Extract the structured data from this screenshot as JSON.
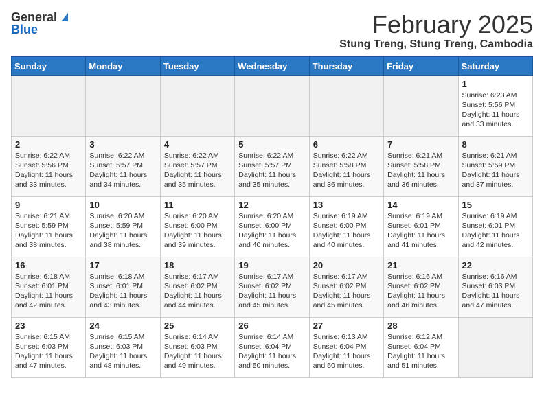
{
  "logo": {
    "general": "General",
    "blue": "Blue"
  },
  "title": "February 2025",
  "location": "Stung Treng, Stung Treng, Cambodia",
  "days_of_week": [
    "Sunday",
    "Monday",
    "Tuesday",
    "Wednesday",
    "Thursday",
    "Friday",
    "Saturday"
  ],
  "weeks": [
    [
      {
        "day": "",
        "info": ""
      },
      {
        "day": "",
        "info": ""
      },
      {
        "day": "",
        "info": ""
      },
      {
        "day": "",
        "info": ""
      },
      {
        "day": "",
        "info": ""
      },
      {
        "day": "",
        "info": ""
      },
      {
        "day": "1",
        "info": "Sunrise: 6:23 AM\nSunset: 5:56 PM\nDaylight: 11 hours\nand 33 minutes."
      }
    ],
    [
      {
        "day": "2",
        "info": "Sunrise: 6:22 AM\nSunset: 5:56 PM\nDaylight: 11 hours\nand 33 minutes."
      },
      {
        "day": "3",
        "info": "Sunrise: 6:22 AM\nSunset: 5:57 PM\nDaylight: 11 hours\nand 34 minutes."
      },
      {
        "day": "4",
        "info": "Sunrise: 6:22 AM\nSunset: 5:57 PM\nDaylight: 11 hours\nand 35 minutes."
      },
      {
        "day": "5",
        "info": "Sunrise: 6:22 AM\nSunset: 5:57 PM\nDaylight: 11 hours\nand 35 minutes."
      },
      {
        "day": "6",
        "info": "Sunrise: 6:22 AM\nSunset: 5:58 PM\nDaylight: 11 hours\nand 36 minutes."
      },
      {
        "day": "7",
        "info": "Sunrise: 6:21 AM\nSunset: 5:58 PM\nDaylight: 11 hours\nand 36 minutes."
      },
      {
        "day": "8",
        "info": "Sunrise: 6:21 AM\nSunset: 5:59 PM\nDaylight: 11 hours\nand 37 minutes."
      }
    ],
    [
      {
        "day": "9",
        "info": "Sunrise: 6:21 AM\nSunset: 5:59 PM\nDaylight: 11 hours\nand 38 minutes."
      },
      {
        "day": "10",
        "info": "Sunrise: 6:20 AM\nSunset: 5:59 PM\nDaylight: 11 hours\nand 38 minutes."
      },
      {
        "day": "11",
        "info": "Sunrise: 6:20 AM\nSunset: 6:00 PM\nDaylight: 11 hours\nand 39 minutes."
      },
      {
        "day": "12",
        "info": "Sunrise: 6:20 AM\nSunset: 6:00 PM\nDaylight: 11 hours\nand 40 minutes."
      },
      {
        "day": "13",
        "info": "Sunrise: 6:19 AM\nSunset: 6:00 PM\nDaylight: 11 hours\nand 40 minutes."
      },
      {
        "day": "14",
        "info": "Sunrise: 6:19 AM\nSunset: 6:01 PM\nDaylight: 11 hours\nand 41 minutes."
      },
      {
        "day": "15",
        "info": "Sunrise: 6:19 AM\nSunset: 6:01 PM\nDaylight: 11 hours\nand 42 minutes."
      }
    ],
    [
      {
        "day": "16",
        "info": "Sunrise: 6:18 AM\nSunset: 6:01 PM\nDaylight: 11 hours\nand 42 minutes."
      },
      {
        "day": "17",
        "info": "Sunrise: 6:18 AM\nSunset: 6:01 PM\nDaylight: 11 hours\nand 43 minutes."
      },
      {
        "day": "18",
        "info": "Sunrise: 6:17 AM\nSunset: 6:02 PM\nDaylight: 11 hours\nand 44 minutes."
      },
      {
        "day": "19",
        "info": "Sunrise: 6:17 AM\nSunset: 6:02 PM\nDaylight: 11 hours\nand 45 minutes."
      },
      {
        "day": "20",
        "info": "Sunrise: 6:17 AM\nSunset: 6:02 PM\nDaylight: 11 hours\nand 45 minutes."
      },
      {
        "day": "21",
        "info": "Sunrise: 6:16 AM\nSunset: 6:02 PM\nDaylight: 11 hours\nand 46 minutes."
      },
      {
        "day": "22",
        "info": "Sunrise: 6:16 AM\nSunset: 6:03 PM\nDaylight: 11 hours\nand 47 minutes."
      }
    ],
    [
      {
        "day": "23",
        "info": "Sunrise: 6:15 AM\nSunset: 6:03 PM\nDaylight: 11 hours\nand 47 minutes."
      },
      {
        "day": "24",
        "info": "Sunrise: 6:15 AM\nSunset: 6:03 PM\nDaylight: 11 hours\nand 48 minutes."
      },
      {
        "day": "25",
        "info": "Sunrise: 6:14 AM\nSunset: 6:03 PM\nDaylight: 11 hours\nand 49 minutes."
      },
      {
        "day": "26",
        "info": "Sunrise: 6:14 AM\nSunset: 6:04 PM\nDaylight: 11 hours\nand 50 minutes."
      },
      {
        "day": "27",
        "info": "Sunrise: 6:13 AM\nSunset: 6:04 PM\nDaylight: 11 hours\nand 50 minutes."
      },
      {
        "day": "28",
        "info": "Sunrise: 6:12 AM\nSunset: 6:04 PM\nDaylight: 11 hours\nand 51 minutes."
      },
      {
        "day": "",
        "info": ""
      }
    ]
  ]
}
